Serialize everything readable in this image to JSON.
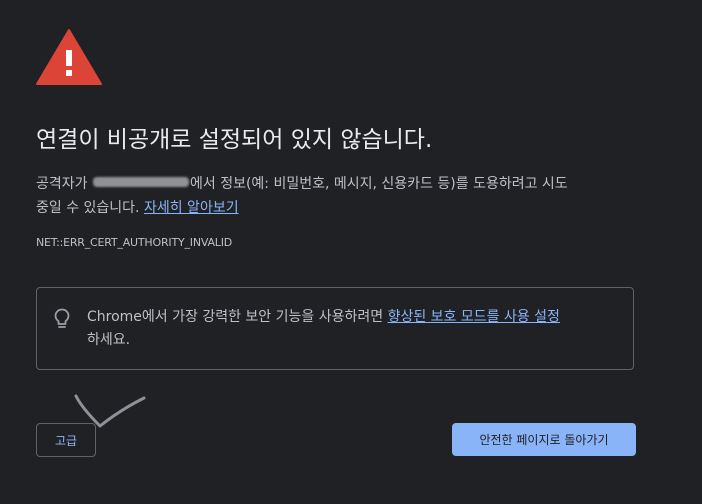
{
  "interstitial": {
    "icon": "warning-triangle-icon",
    "title": "연결이 비공개로 설정되어 있지 않습니다.",
    "description_before_redaction": "공격자가",
    "description_after_redaction": "에서 정보(예: 비밀번호, 메시지, 신용카드 등)를 도용하려고 시도",
    "description_line2": "중일 수 있습니다.",
    "learn_more_link": "자세히 알아보기",
    "error_code": "NET::ERR_CERT_AUTHORITY_INVALID"
  },
  "enhanced_protection_tip": {
    "icon": "lightbulb-icon",
    "text_before_link": "Chrome에서 가장 강력한 보안 기능을 사용하려면",
    "link_text": "향상된 보호 모드를 사용 설정",
    "text_after_link": "하세요."
  },
  "buttons": {
    "advanced_label": "고급",
    "back_to_safety_label": "안전한 페이지로 돌아가기"
  },
  "colors": {
    "background": "#202124",
    "title": "#e8eaed",
    "body_text": "#bdc1c6",
    "link": "#8ab4f8",
    "warning_red": "#db4437",
    "border": "#5f6368"
  }
}
